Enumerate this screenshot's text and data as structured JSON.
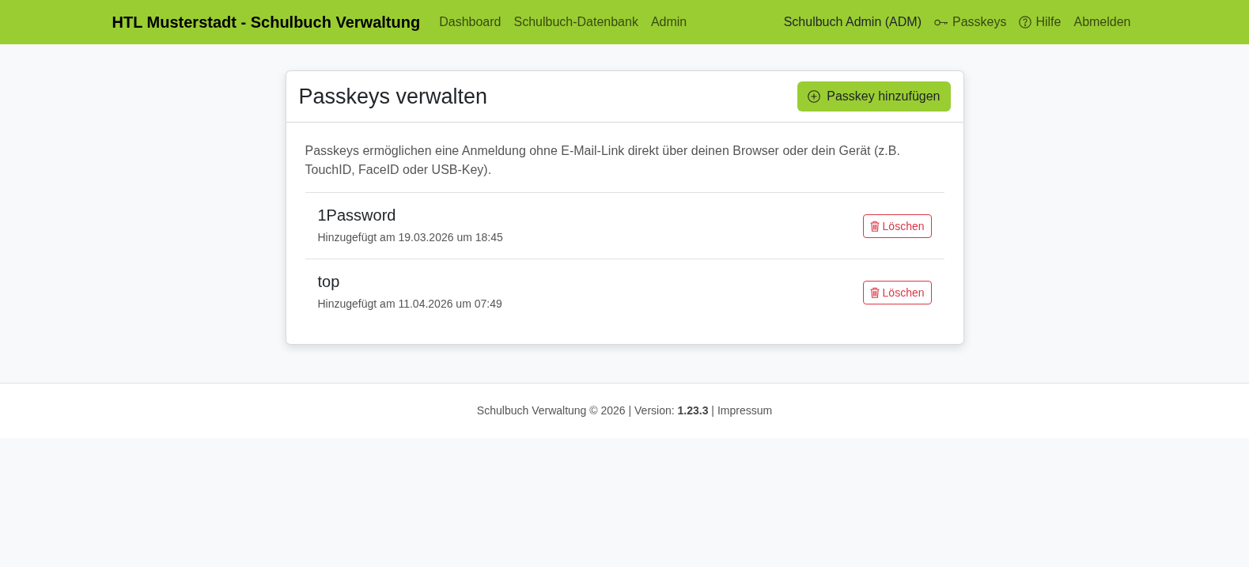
{
  "navbar": {
    "brand": "HTL Musterstadt - Schulbuch Verwaltung",
    "links": [
      "Dashboard",
      "Schulbuch-Datenbank",
      "Admin"
    ],
    "user": "Schulbuch Admin (ADM)",
    "actions": [
      {
        "kind": "key",
        "label": "Passkeys"
      },
      {
        "kind": "help",
        "label": "Hilfe"
      },
      {
        "kind": "plain",
        "label": "Abmelden"
      }
    ]
  },
  "card": {
    "title": "Passkeys verwalten",
    "add_button": "Passkey hinzufügen",
    "description": "Passkeys ermöglichen eine Anmeldung ohne E-Mail-Link direkt über deinen Browser oder dein Gerät (z.B. TouchID, FaceID oder USB-Key).",
    "passkeys": [
      {
        "name": "1Password",
        "added": "Hinzugefügt am 19.03.2026 um 18:45",
        "delete_button": "Löschen"
      },
      {
        "name": "top",
        "added": "Hinzugefügt am 11.04.2026 um 07:49",
        "delete_button": "Löschen"
      }
    ]
  },
  "footer": {
    "text": "Schulbuch Verwaltung © 2026 | Version: **1.23.3** |",
    "link": "Impressum"
  }
}
